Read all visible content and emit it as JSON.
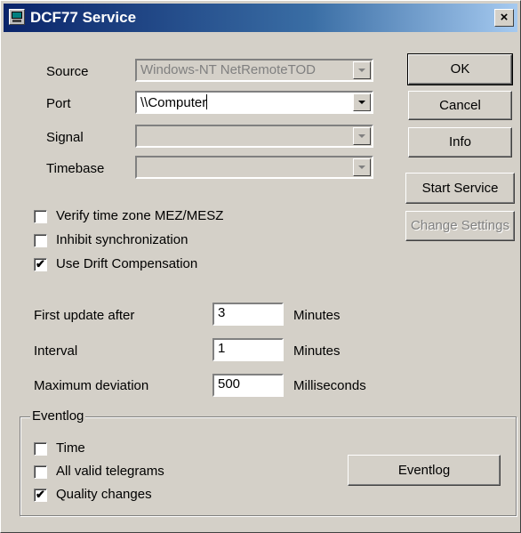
{
  "window": {
    "title": "DCF77 Service",
    "close": "×",
    "icon": "clock-app-icon"
  },
  "fields": {
    "source": {
      "label": "Source",
      "value": "Windows-NT NetRemoteTOD",
      "enabled": false
    },
    "port": {
      "label": "Port",
      "value": "\\\\Computer",
      "enabled": true
    },
    "signal": {
      "label": "Signal",
      "value": "",
      "enabled": false
    },
    "timebase": {
      "label": "Timebase",
      "value": "",
      "enabled": false
    }
  },
  "buttons": {
    "ok": "OK",
    "cancel": "Cancel",
    "info": "Info",
    "start_service": "Start Service",
    "change_settings": "Change Settings",
    "eventlog": "Eventlog"
  },
  "options": [
    {
      "label": "Verify time zone MEZ/MESZ",
      "checked": false
    },
    {
      "label": "Inhibit synchronization",
      "checked": false
    },
    {
      "label": "Use Drift Compensation",
      "checked": true
    }
  ],
  "timing": [
    {
      "label": "First update after",
      "value": "3",
      "unit": "Minutes"
    },
    {
      "label": "Interval",
      "value": "1",
      "unit": "Minutes"
    },
    {
      "label": "Maximum deviation",
      "value": "500",
      "unit": "Milliseconds"
    }
  ],
  "eventlog": {
    "title": "Eventlog",
    "items": [
      {
        "label": "Time",
        "checked": false
      },
      {
        "label": "All valid telegrams",
        "checked": false
      },
      {
        "label": "Quality changes",
        "checked": true
      }
    ]
  },
  "check_mark": "✔"
}
